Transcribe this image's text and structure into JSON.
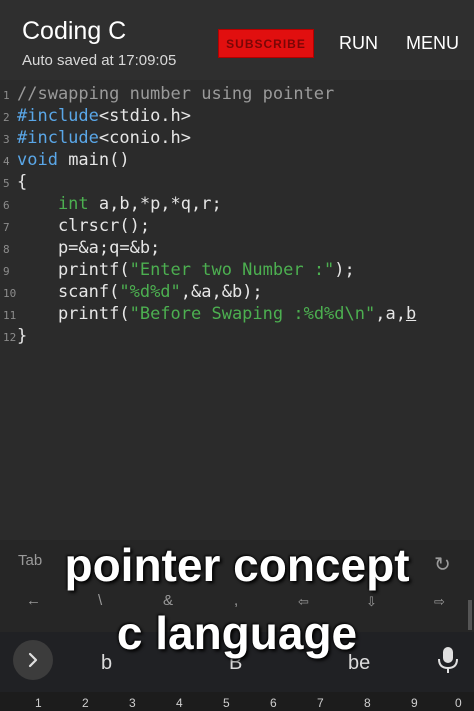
{
  "appbar": {
    "title": "Coding C",
    "subtitle": "Auto saved at 17:09:05",
    "subscribe_label": "SUBSCRIBE",
    "run_label": "RUN",
    "menu_label": "MENU"
  },
  "code": {
    "line_numbers": [
      "1",
      "2",
      "3",
      "4",
      "5",
      "6",
      "7",
      "8",
      "9",
      "10",
      "11",
      "12"
    ],
    "l1": "//swapping number using pointer",
    "l2_kw": "#include",
    "l2_rest": "<stdio.h>",
    "l3_kw": "#include",
    "l3_rest": "<conio.h>",
    "l4_kw": "void",
    "l4_rest": " main()",
    "l5": "{",
    "l6_kw": "    int",
    "l6_rest": " a,b,*p,*q,r;",
    "l7": "    clrscr();",
    "l8": "    p=&a;q=&b;",
    "l9_a": "    printf(",
    "l9_str": "\"Enter two Number :\"",
    "l9_b": ");",
    "l10_a": "    scanf(",
    "l10_str": "\"%d%d\"",
    "l10_b": ",&a,&b);",
    "l11_a": "    printf(",
    "l11_str": "\"Before Swaping :%d%d\\n\"",
    "l11_b": ",a,",
    "l11_c": "b",
    "l12": "}"
  },
  "caption": {
    "line1": "pointer concept",
    "line2": "c language"
  },
  "keyboard": {
    "row1": [
      "Tab",
      "“",
      "↻"
    ],
    "row2": [
      "←",
      "\\",
      "&",
      ",",
      "⇦",
      "⇩",
      "⇨"
    ],
    "suggestions": [
      "b",
      "B",
      "be"
    ],
    "numbers": [
      "1",
      "2",
      "3",
      "4",
      "5",
      "6",
      "7",
      "8",
      "9",
      "0"
    ]
  },
  "colors": {
    "accent_red": "#e10f0f",
    "keyword_blue": "#5aa7e8",
    "string_green": "#4caf50"
  }
}
